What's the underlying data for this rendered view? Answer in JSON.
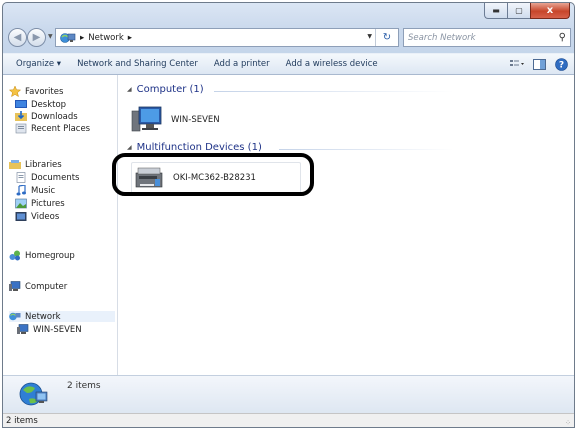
{
  "window": {
    "caption_min": "▬",
    "caption_max": "▢",
    "caption_close": "x"
  },
  "address": {
    "back_glyph": "◀",
    "forward_glyph": "▶",
    "separator": "▸",
    "crumb": "Network",
    "refresh_glyph": "↻",
    "search_placeholder": "Search Network",
    "search_glyph": "⚲"
  },
  "toolbar": {
    "organize": "Organize ▾",
    "network_sharing": "Network and Sharing Center",
    "add_printer": "Add a printer",
    "add_wireless": "Add a wireless device"
  },
  "nav": {
    "favorites": "Favorites",
    "desktop": "Desktop",
    "downloads": "Downloads",
    "recent_places": "Recent Places",
    "libraries": "Libraries",
    "documents": "Documents",
    "music": "Music",
    "pictures": "Pictures",
    "videos": "Videos",
    "homegroup": "Homegroup",
    "computer": "Computer",
    "network": "Network",
    "win_seven": "WIN-SEVEN"
  },
  "groups": {
    "computer": {
      "header": "Computer (1)",
      "device": "WIN-SEVEN"
    },
    "multifunction": {
      "header": "Multifunction Devices (1)",
      "device": "OKI-MC362-B28231"
    }
  },
  "details": {
    "count": "2 items"
  },
  "status": {
    "count": "2 items"
  },
  "colors": {
    "group_header": "#1e3287",
    "toolbar_text": "#1e395b",
    "highlight": "#000000"
  }
}
